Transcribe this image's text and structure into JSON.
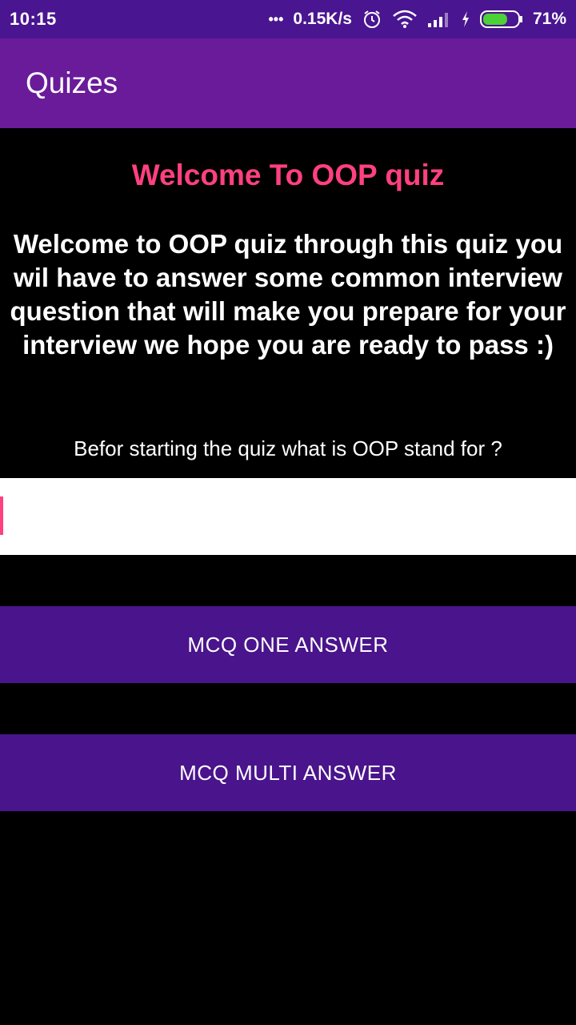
{
  "status_bar": {
    "time": "10:15",
    "dots": "•••",
    "network_speed": "0.15K/s",
    "battery_percent": "71%",
    "battery_level": 0.71,
    "icons": [
      "alarm-icon",
      "wifi-icon",
      "signal-icon",
      "charging-icon",
      "battery-icon"
    ]
  },
  "app_bar": {
    "title": "Quizes"
  },
  "content": {
    "welcome_title": "Welcome To OOP quiz",
    "intro": "Welcome to OOP quiz through this quiz you wil have to answer some common interview question that will make you prepare for your interview we hope you are ready to pass :)",
    "question": "Befor starting the quiz what is OOP stand for ?",
    "answer_value": "",
    "answer_placeholder": ""
  },
  "buttons": {
    "mcq_one": "MCQ ONE ANSWER",
    "mcq_multi": "MCQ MULTI ANSWER"
  },
  "colors": {
    "status_bar": "#4a1590",
    "app_bar": "#6a1b9a",
    "accent": "#ff4081",
    "button": "#4a148c",
    "background": "#000000"
  }
}
